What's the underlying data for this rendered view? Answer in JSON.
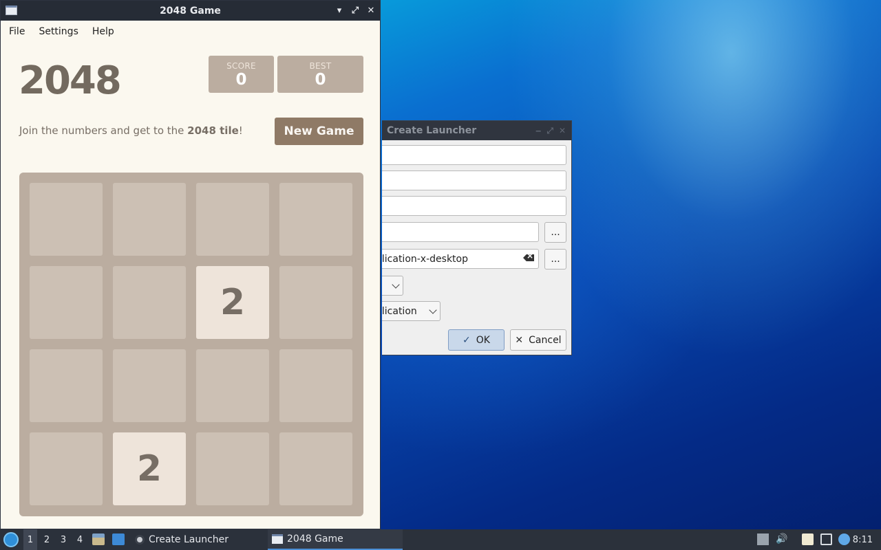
{
  "game_window": {
    "title": "2048 Game",
    "controls": {
      "minimize": "▾",
      "maximize": "⤢",
      "close": "✕"
    },
    "menu": [
      "File",
      "Settings",
      "Help"
    ],
    "heading": "2048",
    "score": {
      "label": "SCORE",
      "value": "0"
    },
    "best": {
      "label": "BEST",
      "value": "0"
    },
    "intro_prefix": "Join the numbers and get to the ",
    "intro_bold": "2048 tile",
    "intro_suffix": "!",
    "new_game_label": "New Game",
    "grid": [
      [
        "",
        "",
        "",
        ""
      ],
      [
        "",
        "",
        "2",
        ""
      ],
      [
        "",
        "",
        "",
        ""
      ],
      [
        "",
        "2",
        "",
        ""
      ]
    ],
    "colors": {
      "board": "#bbada0",
      "tile_2": "#eee4da",
      "text": "#776e65",
      "button": "#8f7a66"
    }
  },
  "launcher_dialog": {
    "title": "Create Launcher",
    "icon_field_value": "plication-x-desktop",
    "browse_label": "...",
    "type_combo_value": "plication",
    "ok_label": "OK",
    "cancel_label": "Cancel"
  },
  "taskbar": {
    "workspaces": [
      "1",
      "2",
      "3",
      "4"
    ],
    "active_workspace": "1",
    "tasks": [
      {
        "label": "Create Launcher",
        "icon": "gear-icon"
      },
      {
        "label": "2048 Game",
        "icon": "window-icon",
        "active": true
      }
    ],
    "clock": "8:11"
  }
}
